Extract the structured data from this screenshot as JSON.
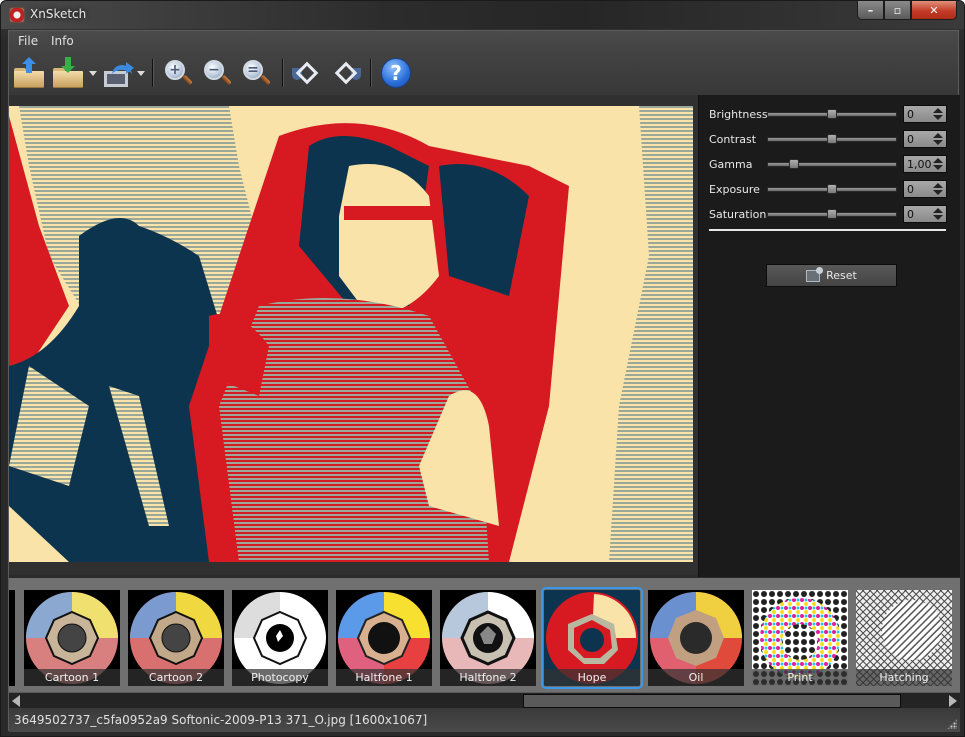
{
  "window": {
    "title": "XnSketch",
    "controls": {
      "minimize": "–",
      "maximize": "▫",
      "close": "✕"
    }
  },
  "menu": [
    {
      "label": "File"
    },
    {
      "label": "Info"
    }
  ],
  "toolbar": {
    "buttons": [
      {
        "name": "open-file",
        "icon": "folder-upload-icon"
      },
      {
        "name": "save-file",
        "icon": "folder-download-icon",
        "has_dropdown": true
      },
      {
        "name": "export",
        "icon": "export-share-icon",
        "has_dropdown": true
      },
      {
        "name": "zoom-in",
        "icon": "zoom-in-icon",
        "symbol": "+"
      },
      {
        "name": "zoom-out",
        "icon": "zoom-out-icon",
        "symbol": "−"
      },
      {
        "name": "zoom-fit",
        "icon": "zoom-fit-icon",
        "symbol": "="
      },
      {
        "name": "rotate-left",
        "icon": "rotate-left-icon"
      },
      {
        "name": "rotate-right",
        "icon": "rotate-right-icon"
      },
      {
        "name": "help",
        "icon": "help-icon",
        "symbol": "?"
      }
    ]
  },
  "adjustments": [
    {
      "label": "Brightness",
      "value": "0",
      "slider_fraction": 0.5
    },
    {
      "label": "Contrast",
      "value": "0",
      "slider_fraction": 0.5
    },
    {
      "label": "Gamma",
      "value": "1,00",
      "slider_fraction": 0.2
    },
    {
      "label": "Exposure",
      "value": "0",
      "slider_fraction": 0.5
    },
    {
      "label": "Saturation",
      "value": "0",
      "slider_fraction": 0.5
    }
  ],
  "reset_label": "Reset",
  "effects": [
    {
      "label": "Cartoon 1",
      "selected": false
    },
    {
      "label": "Cartoon 2",
      "selected": false
    },
    {
      "label": "Photocopy",
      "selected": false
    },
    {
      "label": "Haltfone 1",
      "selected": false
    },
    {
      "label": "Haltfone 2",
      "selected": false
    },
    {
      "label": "Hope",
      "selected": true
    },
    {
      "label": "Oil",
      "selected": false
    },
    {
      "label": "Print",
      "selected": false
    },
    {
      "label": "Hatching",
      "selected": false
    }
  ],
  "palette": {
    "hope_red": "#d71a21",
    "hope_navy": "#0d344e",
    "hope_cream": "#fae3a8",
    "hope_stripe": "#9aa89a",
    "selection_blue": "#3a98e8"
  },
  "status": {
    "file_info": "3649502737_c5fa0952a9 Softonic-2009-P13 371_O.jpg [1600x1067]"
  }
}
